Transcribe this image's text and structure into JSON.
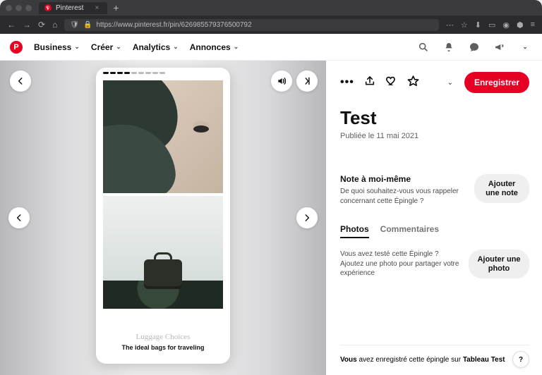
{
  "browser": {
    "tab_title": "Pinterest",
    "url": "https://www.pinterest.fr/pin/626985579376500792"
  },
  "topnav": {
    "business": "Business",
    "create": "Créer",
    "analytics": "Analytics",
    "ads": "Annonces"
  },
  "pin": {
    "save_label": "Enregistrer",
    "title": "Test",
    "published": "Publiée le 11 mai 2021",
    "card_heading": "Luggage Choices",
    "card_sub": "The ideal bags for traveling"
  },
  "note": {
    "heading": "Note à moi-même",
    "desc": "De quoi souhaitez-vous vous rappeler concernant cette Épingle ?",
    "button": "Ajouter une note"
  },
  "tabs": {
    "photos": "Photos",
    "comments": "Commentaires"
  },
  "tried": {
    "desc1": "Vous avez testé cette Épingle ?",
    "desc2": "Ajoutez une photo pour partager votre expérience",
    "button": "Ajouter une photo"
  },
  "footer": {
    "prefix": "Vous",
    "text": " avez enregistré cette épingle sur ",
    "board": "Tableau Test"
  }
}
